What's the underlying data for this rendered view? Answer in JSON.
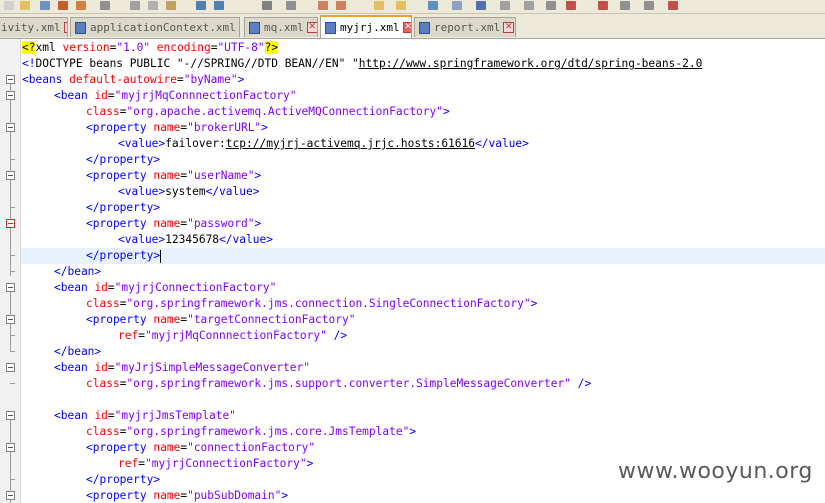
{
  "tabs": [
    {
      "label": "ivity.xml",
      "active": false
    },
    {
      "label": "applicationContext.xml",
      "active": false
    },
    {
      "label": "mq.xml",
      "active": false
    },
    {
      "label": "myjrj.xml",
      "active": true
    },
    {
      "label": "report.xml",
      "active": false
    }
  ],
  "code": {
    "l1": {
      "pi_open": "<?",
      "name": "xml",
      "attr1": "version",
      "val1": "\"1.0\"",
      "attr2": "encoding",
      "val2": "\"UTF-8\"",
      "pi_close": "?>"
    },
    "l2": {
      "open": "<!",
      "text": "DOCTYPE beans PUBLIC \"-//SPRING//DTD BEAN//EN\" \"",
      "url": "http://www.springframework.org/dtd/spring-beans-2.0"
    },
    "l3": {
      "tag": "<beans",
      "attr": "default-autowire",
      "val": "\"byName\"",
      "close": ">"
    },
    "l4": {
      "tag": "<bean",
      "attr": "id",
      "val": "\"myjrjMqConnnectionFactory\""
    },
    "l5": {
      "attr": "class",
      "val": "\"org.apache.activemq.ActiveMQConnectionFactory\"",
      "close": ">"
    },
    "l6": {
      "tag": "<property",
      "attr": "name",
      "val": "\"brokerURL\"",
      "close": ">"
    },
    "l7": {
      "open": "<value>",
      "text_pre": "failover:",
      "url": "tcp://myjrj-activemq.jrjc.hosts:61616",
      "close": "</value>"
    },
    "l8": {
      "tag": "</property>"
    },
    "l9": {
      "tag": "<property",
      "attr": "name",
      "val": "\"userName\"",
      "close": ">"
    },
    "l10": {
      "open": "<value>",
      "text": "system",
      "close": "</value>"
    },
    "l11": {
      "tag": "</property>"
    },
    "l12": {
      "tag": "<property",
      "attr": "name",
      "val": "\"password\"",
      "close": ">"
    },
    "l13": {
      "open": "<value>",
      "text": "12345678",
      "close": "</value>"
    },
    "l14": {
      "tag": "</property>"
    },
    "l15": {
      "tag": "</bean>"
    },
    "l16": {
      "tag": "<bean",
      "attr": "id",
      "val": "\"myjrjConnectionFactory\""
    },
    "l17": {
      "attr": "class",
      "val": "\"org.springframework.jms.connection.SingleConnectionFactory\"",
      "close": ">"
    },
    "l18": {
      "tag": "<property",
      "attr": "name",
      "val": "\"targetConnectionFactory\""
    },
    "l19": {
      "attr": "ref",
      "val": "\"myjrjMqConnnectionFactory\"",
      "close": "/>"
    },
    "l20": {
      "tag": "</bean>"
    },
    "l21": {
      "tag": "<bean",
      "attr": "id",
      "val": "\"myJrjSimpleMessageConverter\""
    },
    "l22": {
      "attr": "class",
      "val": "\"org.springframework.jms.support.converter.SimpleMessageConverter\"",
      "close": "/>"
    },
    "l24": {
      "tag": "<bean",
      "attr": "id",
      "val": "\"myjrjJmsTemplate\""
    },
    "l25": {
      "attr": "class",
      "val": "\"org.springframework.jms.core.JmsTemplate\"",
      "close": ">"
    },
    "l26": {
      "tag": "<property",
      "attr": "name",
      "val": "\"connectionFactory\""
    },
    "l27": {
      "attr": "ref",
      "val": "\"myjrjConnectionFactory\"",
      "close": ">"
    },
    "l28": {
      "tag": "</property>"
    },
    "l29": {
      "tag": "<property",
      "attr": "name",
      "val": "\"pubSubDomain\"",
      "close": ">"
    }
  },
  "watermark": "www.wooyun.org",
  "colors": {
    "tag": "#0000ff",
    "attr": "#ff0000",
    "string": "#8000ff",
    "pi_highlight": "#ffff00",
    "active_tab_accent": "#f0a030"
  }
}
